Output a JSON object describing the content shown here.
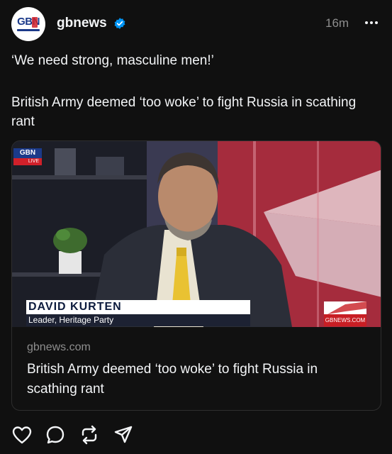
{
  "post": {
    "username": "gbnews",
    "timestamp": "16m",
    "caption_quote": "‘We need strong, masculine men!’",
    "caption_body": "British Army deemed ‘too woke’ to fight Russia in scathing rant"
  },
  "link_card": {
    "domain": "gbnews.com",
    "title": "British Army deemed ‘too woke’ to fight Russia in scathing rant",
    "image": {
      "channel_logo": "GBN",
      "live_label": "LIVE",
      "lower_third_name": "DAVID KURTEN",
      "lower_third_role": "Leader, Heritage Party",
      "url_badge": "GBNEWS.COM"
    }
  },
  "avatar": {
    "logo_text": "GBN"
  },
  "icons": {
    "verified": "verified-badge-icon",
    "more": "more-options-icon",
    "like": "heart-icon",
    "comment": "comment-bubble-icon",
    "repost": "repost-icon",
    "share": "send-icon"
  },
  "colors": {
    "background": "#101010",
    "text": "#f3f5f7",
    "muted": "#8e8e8e",
    "verified_blue": "#0095f6",
    "brand_navy": "#1b3a8a",
    "brand_red": "#d0202a"
  }
}
